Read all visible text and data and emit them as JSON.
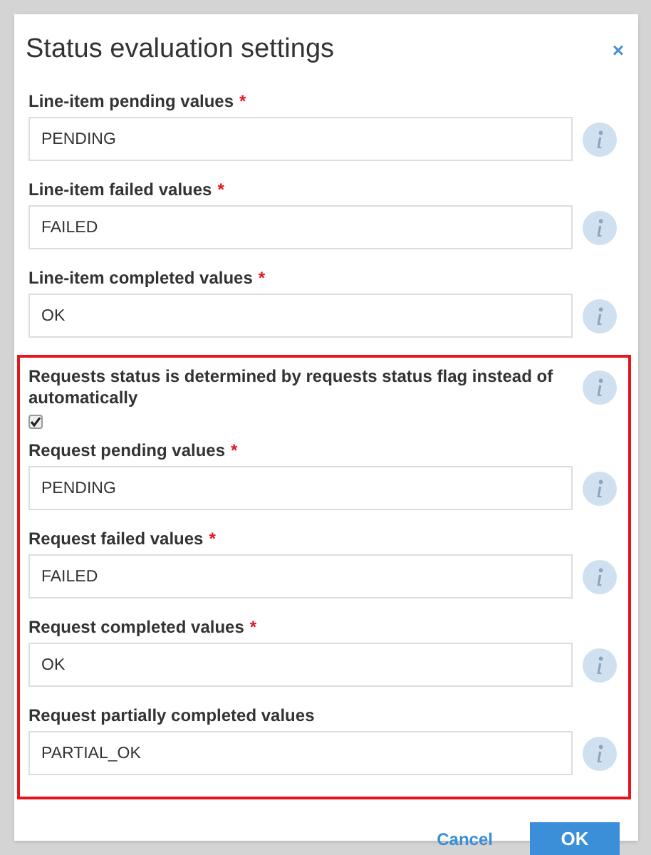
{
  "dialog": {
    "title": "Status evaluation settings",
    "close": "×"
  },
  "fields": [
    {
      "kind": "text",
      "label": "Line-item pending values",
      "required_mark": "*",
      "value": "PENDING"
    },
    {
      "kind": "text",
      "label": "Line-item failed values",
      "required_mark": "*",
      "value": "FAILED"
    },
    {
      "kind": "text",
      "label": "Line-item completed values",
      "required_mark": "*",
      "value": "OK"
    }
  ],
  "highlighted_section": {
    "fields": [
      {
        "kind": "checkbox",
        "label": "Requests status is determined by requests status flag instead of automatically",
        "checked": true
      },
      {
        "kind": "text",
        "label": "Request pending values",
        "required_mark": "*",
        "value": "PENDING"
      },
      {
        "kind": "text",
        "label": "Request failed values",
        "required_mark": "*",
        "value": "FAILED"
      },
      {
        "kind": "text",
        "label": "Request completed values",
        "required_mark": "*",
        "value": "OK"
      },
      {
        "kind": "text",
        "label": "Request partially completed values",
        "value": "PARTIAL_OK"
      }
    ]
  },
  "buttons": {
    "cancel": "Cancel",
    "ok": "OK"
  }
}
